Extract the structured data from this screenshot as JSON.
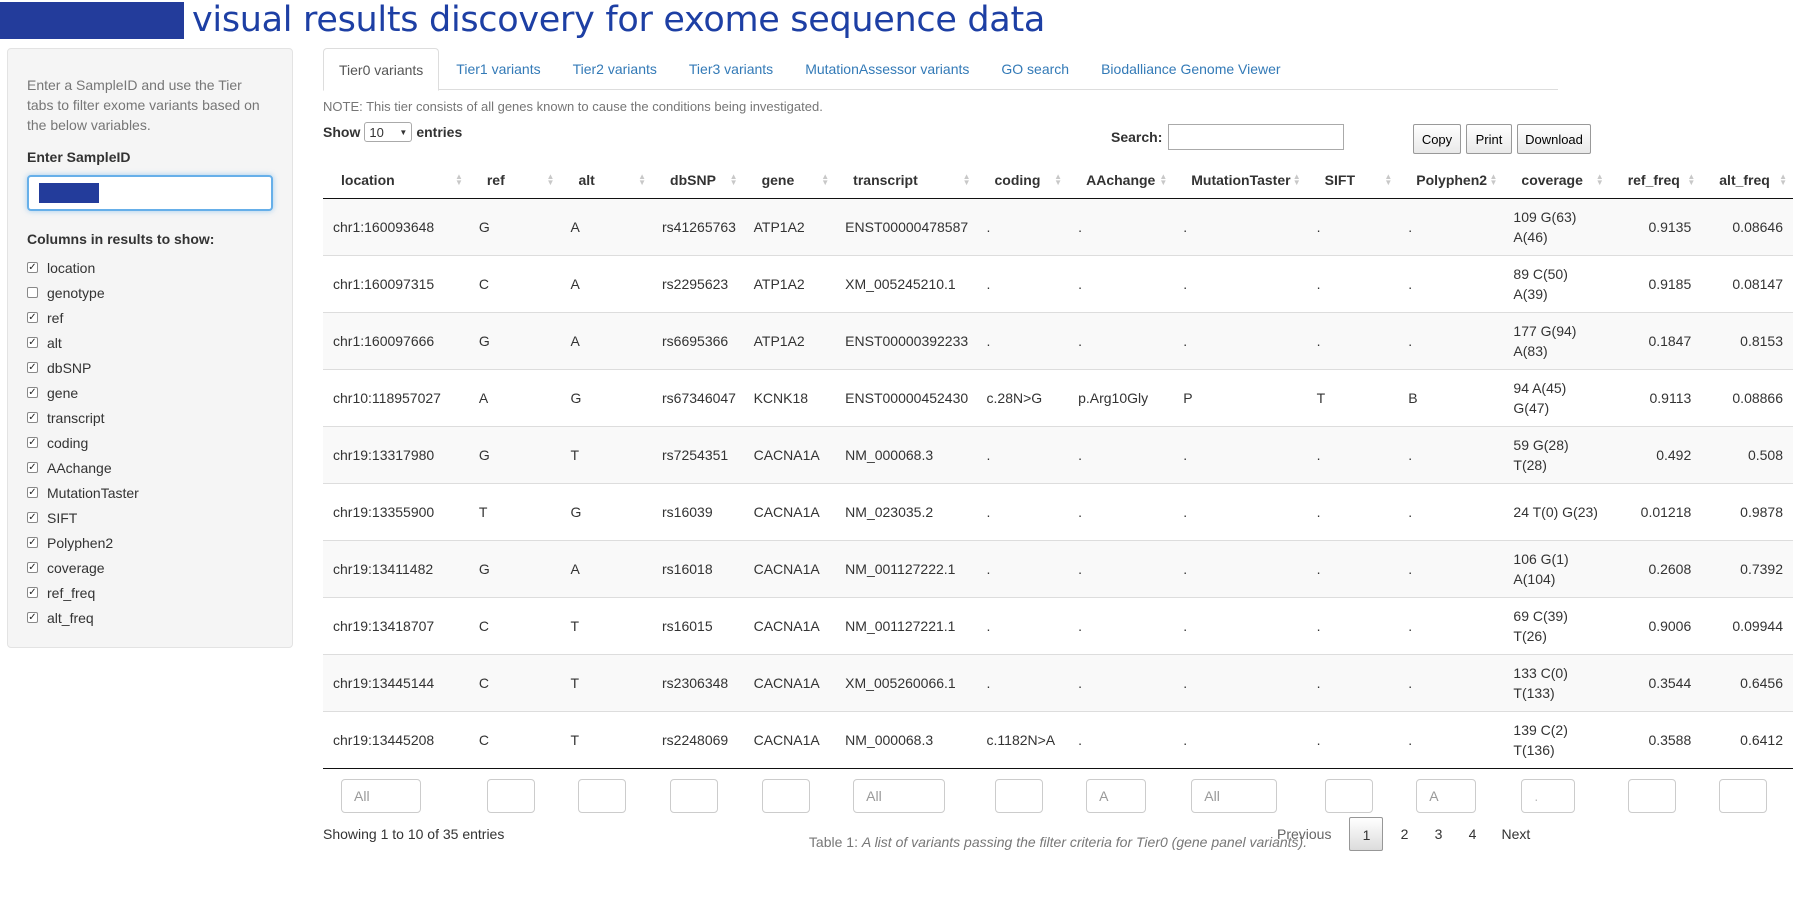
{
  "app": {
    "title": "visual results discovery for exome sequence data",
    "brand_color": "#233c9b"
  },
  "sidebar": {
    "hint": "Enter a SampleID and use the Tier tabs to filter exome variants based on the below variables.",
    "sample_label": "Enter SampleID",
    "columns_label": "Columns in results to show:",
    "columns": [
      {
        "label": "location",
        "checked": true
      },
      {
        "label": "genotype",
        "checked": false
      },
      {
        "label": "ref",
        "checked": true
      },
      {
        "label": "alt",
        "checked": true
      },
      {
        "label": "dbSNP",
        "checked": true
      },
      {
        "label": "gene",
        "checked": true
      },
      {
        "label": "transcript",
        "checked": true
      },
      {
        "label": "coding",
        "checked": true
      },
      {
        "label": "AAchange",
        "checked": true
      },
      {
        "label": "MutationTaster",
        "checked": true
      },
      {
        "label": "SIFT",
        "checked": true
      },
      {
        "label": "Polyphen2",
        "checked": true
      },
      {
        "label": "coverage",
        "checked": true
      },
      {
        "label": "ref_freq",
        "checked": true
      },
      {
        "label": "alt_freq",
        "checked": true
      }
    ]
  },
  "tabs": [
    "Tier0 variants",
    "Tier1 variants",
    "Tier2 variants",
    "Tier3 variants",
    "MutationAssessor variants",
    "GO search",
    "Biodalliance Genome Viewer"
  ],
  "note": "NOTE: This tier consists of all genes known to cause the conditions being investigated.",
  "controls": {
    "show": "Show",
    "entries": "entries",
    "length_value": "10",
    "search_label": "Search:",
    "copy": "Copy",
    "print": "Print",
    "download": "Download"
  },
  "table": {
    "headers": [
      "location",
      "ref",
      "alt",
      "dbSNP",
      "gene",
      "transcript",
      "coding",
      "AAchange",
      "MutationTaster",
      "SIFT",
      "Polyphen2",
      "coverage",
      "ref_freq",
      "alt_freq"
    ],
    "rows": [
      [
        "chr1:160093648",
        "G",
        "A",
        "rs41265763",
        "ATP1A2",
        "ENST00000478587",
        ".",
        ".",
        ".",
        ".",
        ".",
        "109 G(63) A(46)",
        "0.9135",
        "0.08646"
      ],
      [
        "chr1:160097315",
        "C",
        "A",
        "rs2295623",
        "ATP1A2",
        "XM_005245210.1",
        ".",
        ".",
        ".",
        ".",
        ".",
        "89 C(50) A(39)",
        "0.9185",
        "0.08147"
      ],
      [
        "chr1:160097666",
        "G",
        "A",
        "rs6695366",
        "ATP1A2",
        "ENST00000392233",
        ".",
        ".",
        ".",
        ".",
        ".",
        "177 G(94) A(83)",
        "0.1847",
        "0.8153"
      ],
      [
        "chr10:118957027",
        "A",
        "G",
        "rs67346047",
        "KCNK18",
        "ENST00000452430",
        "c.28N>G",
        "p.Arg10Gly",
        "P",
        "T",
        "B",
        "94 A(45) G(47)",
        "0.9113",
        "0.08866"
      ],
      [
        "chr19:13317980",
        "G",
        "T",
        "rs7254351",
        "CACNA1A",
        "NM_000068.3",
        ".",
        ".",
        ".",
        ".",
        ".",
        "59 G(28) T(28)",
        "0.492",
        "0.508"
      ],
      [
        "chr19:13355900",
        "T",
        "G",
        "rs16039",
        "CACNA1A",
        "NM_023035.2",
        ".",
        ".",
        ".",
        ".",
        ".",
        "24 T(0) G(23)",
        "0.01218",
        "0.9878"
      ],
      [
        "chr19:13411482",
        "G",
        "A",
        "rs16018",
        "CACNA1A",
        "NM_001127222.1",
        ".",
        ".",
        ".",
        ".",
        ".",
        "106 G(1) A(104)",
        "0.2608",
        "0.7392"
      ],
      [
        "chr19:13418707",
        "C",
        "T",
        "rs16015",
        "CACNA1A",
        "NM_001127221.1",
        ".",
        ".",
        ".",
        ".",
        ".",
        "69 C(39) T(26)",
        "0.9006",
        "0.09944"
      ],
      [
        "chr19:13445144",
        "C",
        "T",
        "rs2306348",
        "CACNA1A",
        "XM_005260066.1",
        ".",
        ".",
        ".",
        ".",
        ".",
        "133 C(0) T(133)",
        "0.3544",
        "0.6456"
      ],
      [
        "chr19:13445208",
        "C",
        "T",
        "rs2248069",
        "CACNA1A",
        "NM_000068.3",
        "c.1182N>A",
        ".",
        ".",
        ".",
        ".",
        "139 C(2) T(136)",
        "0.3588",
        "0.6412"
      ]
    ],
    "filters": [
      "All",
      "",
      "",
      "",
      "",
      "All",
      "",
      "A",
      "All",
      "",
      "A",
      ".",
      "",
      ""
    ]
  },
  "caption": {
    "prefix": "Table 1: ",
    "text": "A list of variants passing the filter criteria for Tier0 (gene panel variants)."
  },
  "info": "Showing 1 to 10 of 35 entries",
  "pagination": {
    "previous": "Previous",
    "pages": [
      "1",
      "2",
      "3",
      "4"
    ],
    "next": "Next",
    "current": "1"
  }
}
